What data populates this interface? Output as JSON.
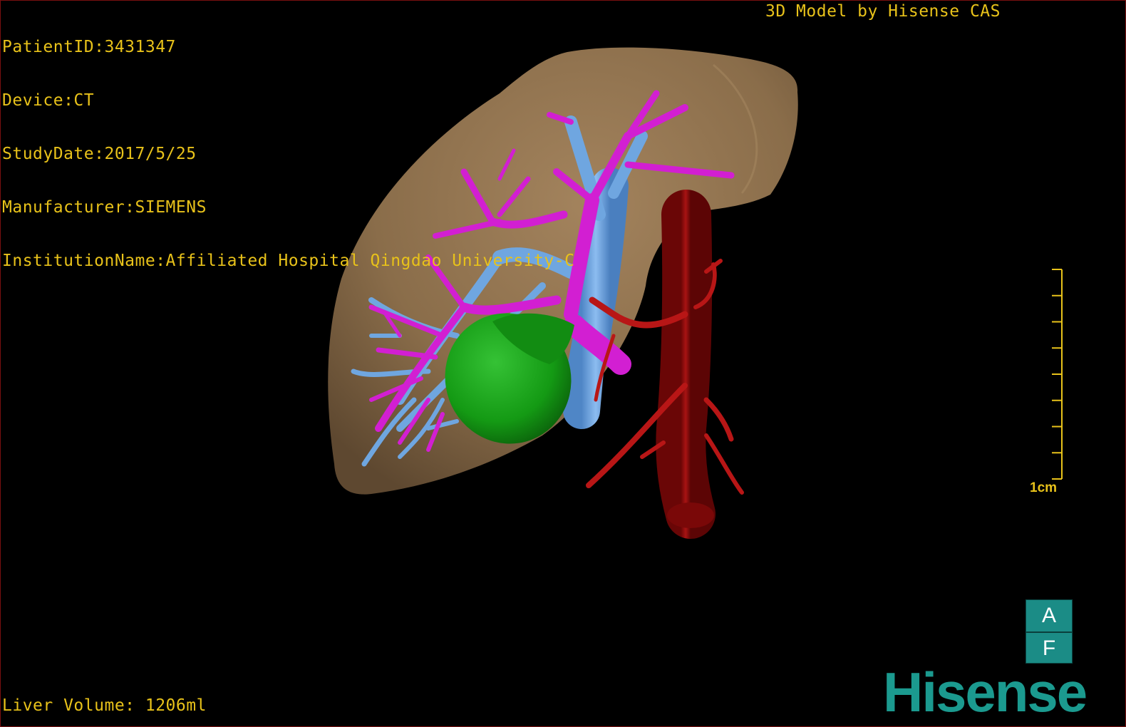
{
  "info": {
    "patient_id": "PatientID:3431347",
    "device": "Device:CT",
    "study_date": "StudyDate:2017/5/25",
    "manufacturer": "Manufacturer:SIEMENS",
    "institution": "InstitutionName:Affiliated Hospital Qingdao University-C"
  },
  "credit": "3D Model by Hisense CAS",
  "liver_volume": "Liver Volume: 1206ml",
  "scale": {
    "label": "1cm",
    "ticks": 9
  },
  "orientation": {
    "top": "A",
    "bottom": "F"
  },
  "brand": "Hisense",
  "colors": {
    "overlay_text": "#e8c21a",
    "liver": "#8a6d4a",
    "portal_vein": "#d21fd2",
    "hepatic_vein": "#6fa6e0",
    "artery": "#9e0e0e",
    "tumor": "#149a14",
    "brand": "#1b9a8f",
    "frame_border": "#7a1010"
  },
  "model": {
    "structures": [
      "liver",
      "hepatic-vein",
      "portal-vein",
      "tumor",
      "artery"
    ]
  }
}
